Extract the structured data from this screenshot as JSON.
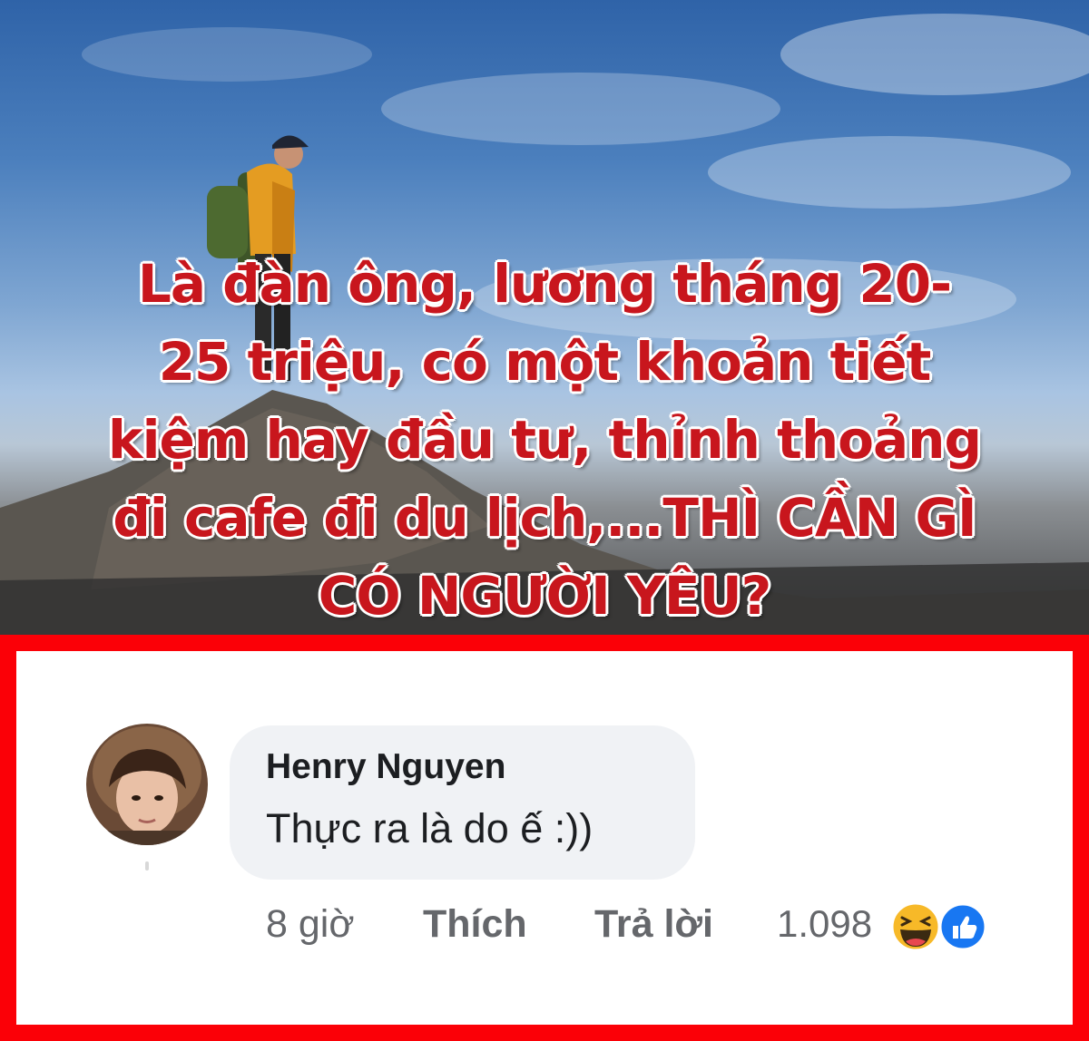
{
  "post": {
    "headline_lines": [
      "Là đàn ông, lương tháng 20-",
      "25 triệu, có một khoản tiết",
      "kiệm hay đầu tư, thỉnh thoảng",
      "đi cafe đi du lịch,...THÌ CẦN GÌ",
      "CÓ NGƯỜI YÊU?"
    ]
  },
  "comment": {
    "author": "Henry Nguyen",
    "text": "Thực ra là do ế :))",
    "time": "8 giờ",
    "like_label": "Thích",
    "reply_label": "Trả lời",
    "reaction_count": "1.098",
    "reaction_icons": [
      "haha-icon",
      "like-icon"
    ]
  },
  "colors": {
    "headline_text": "#c8161d",
    "panel_border": "#fb0007",
    "bubble_bg": "#f0f2f5",
    "meta_text": "#65676b",
    "like_blue": "#1877f2",
    "haha_yellow": "#f7b928"
  }
}
